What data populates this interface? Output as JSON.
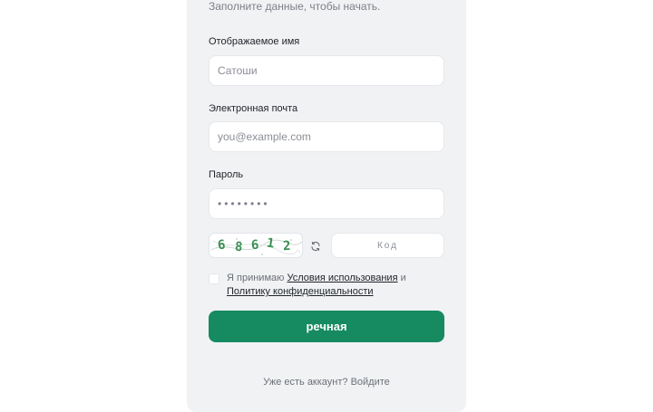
{
  "form": {
    "subtitle": "Заполните данные, чтобы начать.",
    "display_name": {
      "label": "Отображаемое имя",
      "placeholder": "Сатоши"
    },
    "email": {
      "label": "Электронная почта",
      "placeholder": "you@example.com"
    },
    "password": {
      "label": "Пароль",
      "placeholder": "••••••••"
    },
    "captcha": {
      "digits": [
        "6",
        "8",
        "6",
        "1",
        "2"
      ],
      "code_placeholder": "Код"
    },
    "terms": {
      "prefix": "Я принимаю",
      "terms_link": "Условия использования",
      "conjunction": "и",
      "privacy_link": "Политику конфиденциальности"
    },
    "submit_label": "речная",
    "login_prompt": "Уже есть аккаунт? Войдите"
  },
  "colors": {
    "accent": "#168a60",
    "captcha_digits": "#3a8f55",
    "card_background": "#f1f2f4"
  },
  "icons": {
    "refresh": "refresh-icon"
  }
}
